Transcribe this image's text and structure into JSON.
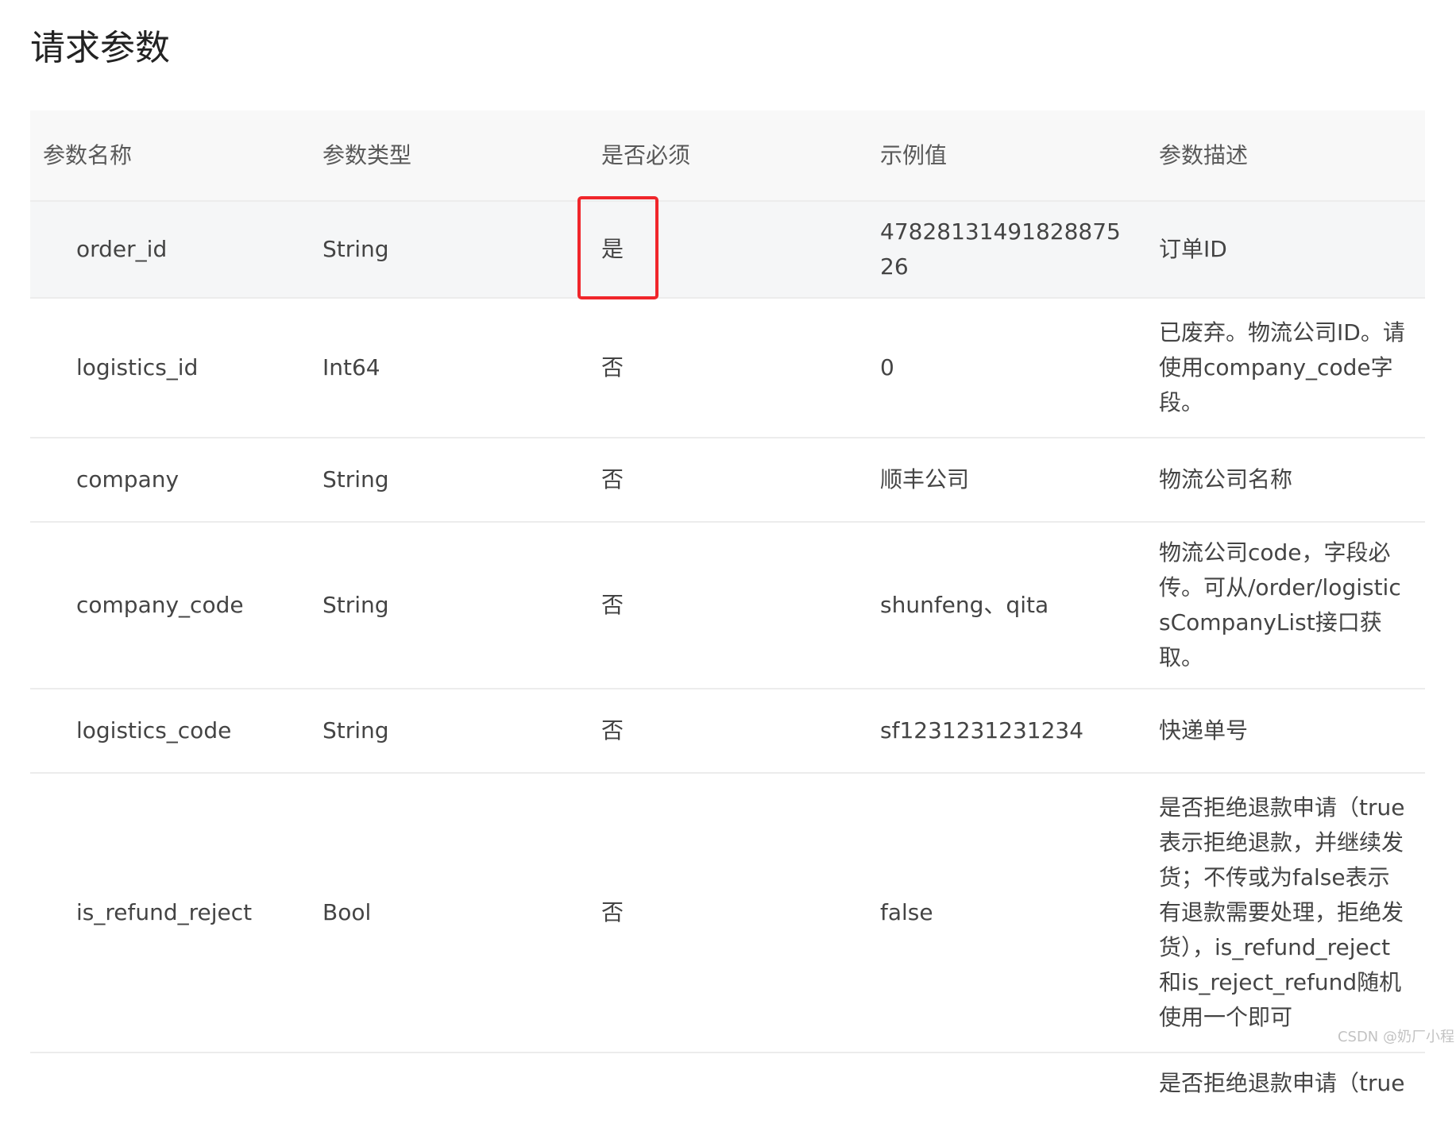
{
  "page": {
    "title": "请求参数"
  },
  "table": {
    "headers": [
      "参数名称",
      "参数类型",
      "是否必须",
      "示例值",
      "参数描述"
    ],
    "rows": [
      {
        "name": "order_id",
        "type": "String",
        "required": "是",
        "example": "4782813149182887526",
        "description": "订单ID"
      },
      {
        "name": "logistics_id",
        "type": "Int64",
        "required": "否",
        "example": "0",
        "description": "已废弃。物流公司ID。请使用company_code字段。"
      },
      {
        "name": "company",
        "type": "String",
        "required": "否",
        "example": "顺丰公司",
        "description": "物流公司名称"
      },
      {
        "name": "company_code",
        "type": "String",
        "required": "否",
        "example": "shunfeng、qita",
        "description": "物流公司code，字段必传。可从/order/logisticsCompanyList接口获取。"
      },
      {
        "name": "logistics_code",
        "type": "String",
        "required": "否",
        "example": "sf1231231231234",
        "description": "快递单号"
      },
      {
        "name": "is_refund_reject",
        "type": "Bool",
        "required": "否",
        "example": "false",
        "description": "是否拒绝退款申请（true表示拒绝退款，并继续发货；不传或为false表示有退款需要处理，拒绝发货），is_refund_reject和is_reject_refund随机使用一个即可"
      },
      {
        "name": "",
        "type": "",
        "required": "",
        "example": "",
        "description": "是否拒绝退款申请（true"
      }
    ]
  },
  "watermark": "CSDN @奶厂小程",
  "colors": {
    "highlight_border": "#f0262b",
    "header_background": "#f8f8f8",
    "highlighted_row_background": "#f5f6f7"
  }
}
